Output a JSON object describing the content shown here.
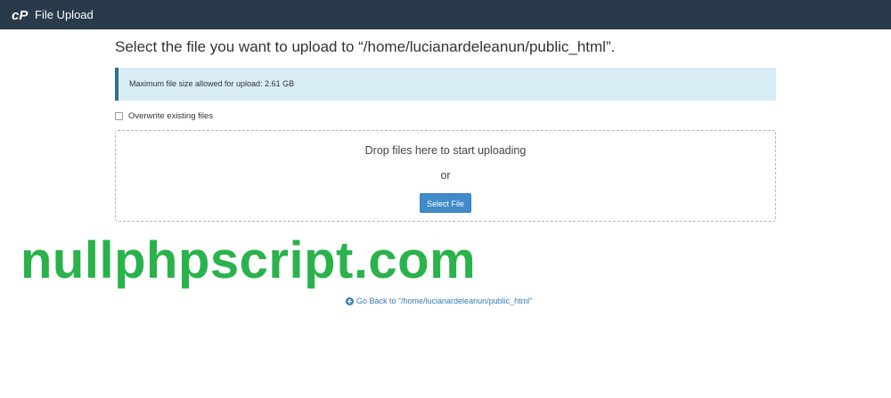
{
  "header": {
    "app_title": "File Upload",
    "logo_icon": "cpanel-logo-icon",
    "background_color": "#293a4a"
  },
  "main": {
    "heading": "Select the file you want to upload to “/home/lucianardeleanun/public_html”.",
    "alert_text": "Maximum file size allowed for upload: 2.61 GB",
    "overwrite_label": "Overwrite existing files",
    "overwrite_checked": false,
    "dropzone": {
      "drop_text": "Drop files here to start uploading",
      "or_text": "or",
      "select_button_label": "Select File"
    },
    "go_back_link": "Go Back to “/home/lucianardeleanun/public_html”",
    "go_back_icon": "arrow-circle-left-icon"
  },
  "watermark": {
    "text": "nullphpscript.com",
    "color": "#2ab24b"
  },
  "colors": {
    "accent": "#428bca",
    "alert_bg": "#d9edf7",
    "link": "#337ab7"
  }
}
